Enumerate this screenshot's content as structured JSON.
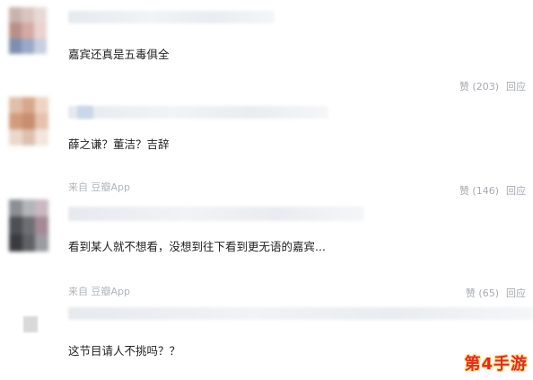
{
  "comments": [
    {
      "text": "嘉宾还真是五毒俱全",
      "likes": "赞 (203)",
      "reply": "回应",
      "source": ""
    },
    {
      "text": "薛之谦？董洁？吉辞",
      "likes": "赞 (146)",
      "reply": "回应",
      "source": "来自 豆瓣App"
    },
    {
      "text": "看到某人就不想看，没想到往下看到更无语的嘉宾...",
      "likes": "赞 (65)",
      "reply": "回应",
      "source": "来自 豆瓣App"
    },
    {
      "text": "这节目请人不挑吗？？",
      "likes": "",
      "reply": "",
      "source": ""
    }
  ],
  "watermark": "第4手游",
  "colors": {
    "text": "#222222",
    "muted": "#a6aab0",
    "watermark": "#e8281e"
  }
}
